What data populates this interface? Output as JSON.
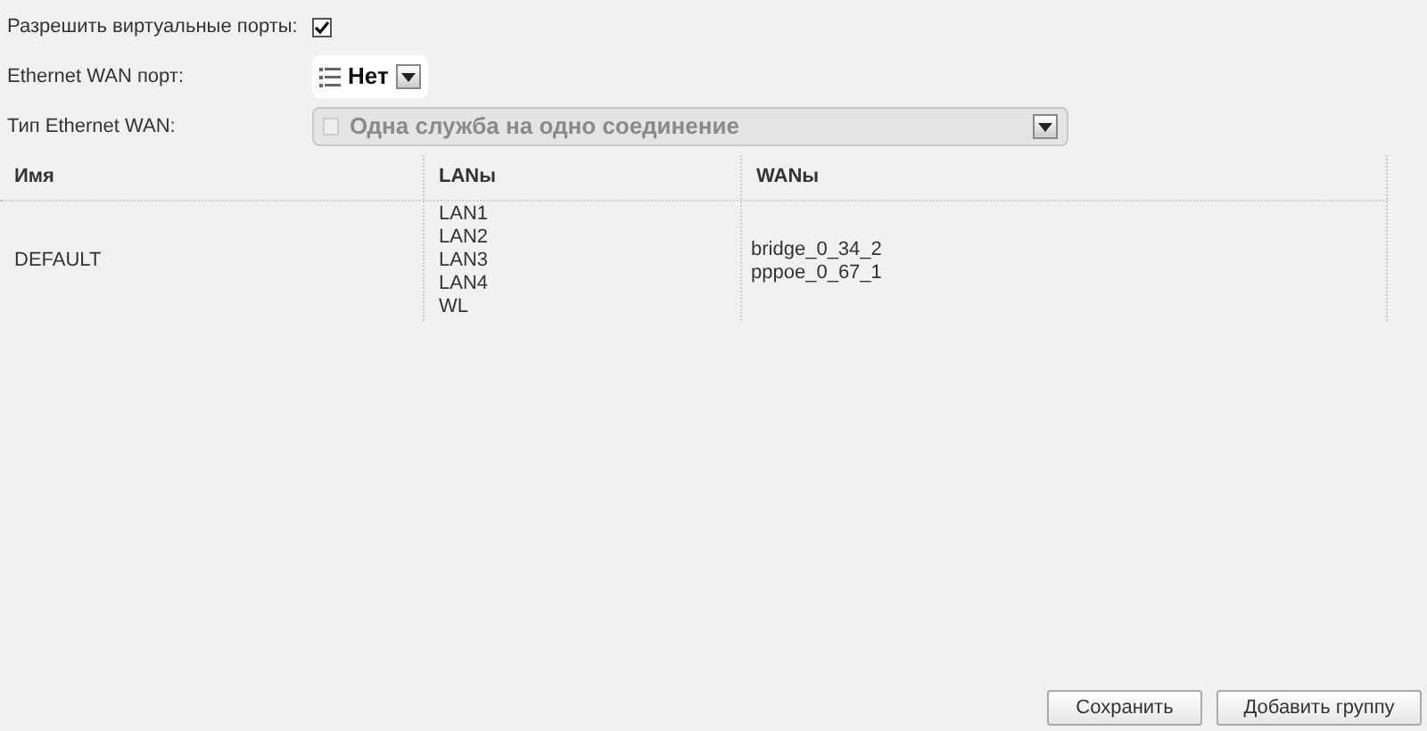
{
  "settings": [
    {
      "kind": "checkbox",
      "label": "Разрешить виртуальные порты:",
      "checked": true
    },
    {
      "kind": "select",
      "label": "Ethernet WAN порт:",
      "value": "Нет",
      "disabled": false
    },
    {
      "kind": "select",
      "label": "Тип Ethernet WAN:",
      "value": "Одна служба на одно соединение",
      "disabled": true
    }
  ],
  "table": {
    "columns": [
      "Имя",
      "LANы",
      "WANы"
    ],
    "rows": [
      {
        "name": "DEFAULT",
        "lans": [
          "LAN1",
          "LAN2",
          "LAN3",
          "LAN4",
          "WL"
        ],
        "wans": [
          "bridge_0_34_2",
          "pppoe_0_67_1"
        ]
      }
    ]
  },
  "buttons": [
    "Сохранить",
    "Добавить группу"
  ]
}
